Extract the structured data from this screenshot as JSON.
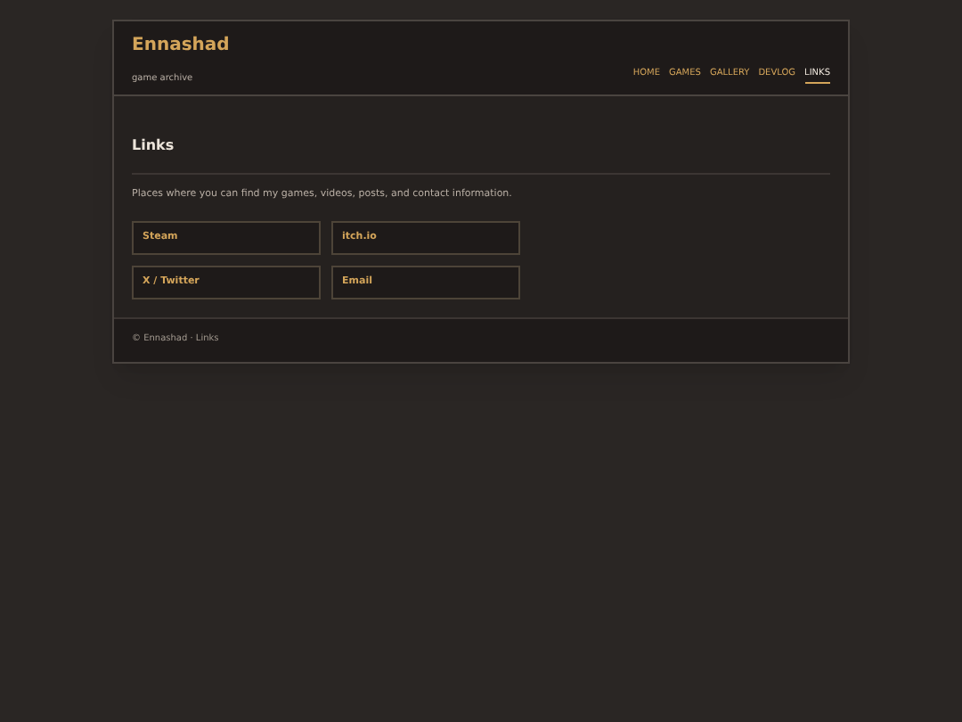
{
  "site": {
    "title": "Ennashad",
    "tagline": "game archive"
  },
  "nav": [
    {
      "label": "HOME",
      "selected": false
    },
    {
      "label": "GAMES",
      "selected": false
    },
    {
      "label": "GALLERY",
      "selected": false
    },
    {
      "label": "DEVLOG",
      "selected": false
    },
    {
      "label": "LINKS",
      "selected": true
    }
  ],
  "page": {
    "heading": "Links",
    "intro": "Places where you can find my games, videos, posts, and contact information."
  },
  "links": [
    {
      "label": "Steam"
    },
    {
      "label": "itch.io"
    },
    {
      "label": "X / Twitter"
    },
    {
      "label": "Email"
    }
  ],
  "footer": "© Ennashad · Links"
}
